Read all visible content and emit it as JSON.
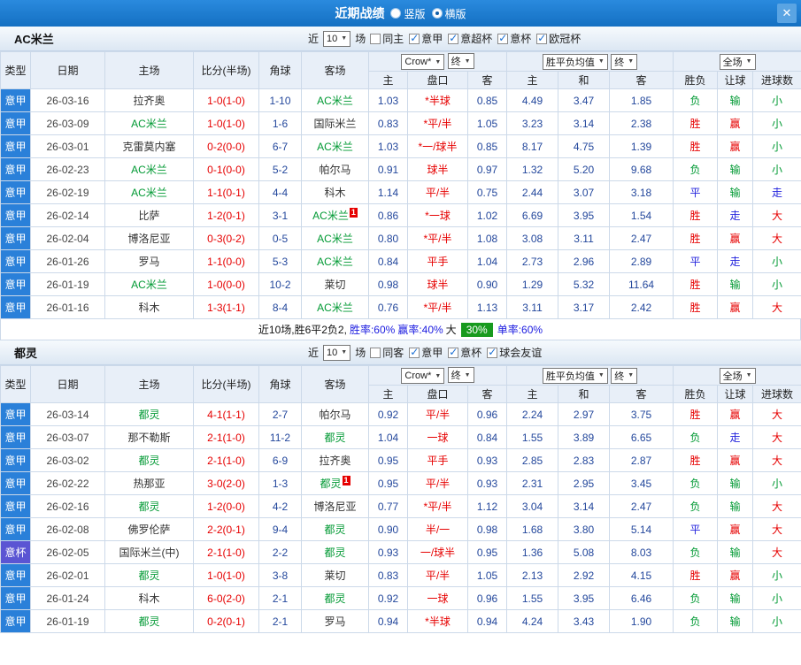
{
  "topbar": {
    "title": "近期战绩",
    "radios": [
      {
        "label": "竖版",
        "selected": false
      },
      {
        "label": "横版",
        "selected": true
      }
    ],
    "close_label": "✕"
  },
  "table": {
    "headers": {
      "type": "类型",
      "date": "日期",
      "home": "主场",
      "score": "比分(半场)",
      "corner": "角球",
      "away": "客场",
      "odds_home": "主",
      "handicap": "盘口",
      "odds_away": "客",
      "avg_home": "主",
      "avg_draw": "和",
      "avg_away": "客",
      "result": "胜负",
      "let_result": "让球",
      "goals": "进球数"
    },
    "dropdowns": {
      "odds_source": "Crow*",
      "odds_final": "终",
      "avg_source": "胜平负均值",
      "avg_final": "终",
      "scope": "全场"
    }
  },
  "colors": {
    "word": {
      "胜": "#e60000",
      "负": "#009933",
      "平": "#2323dd",
      "赢": "#e60000",
      "输": "#009933",
      "走": "#2323dd",
      "大": "#e60000",
      "小": "#009933"
    },
    "type_bg": {
      "意甲": "#2a80d9",
      "意杯": "#5b55d3"
    },
    "focus_team": "#009933",
    "plain_team": "#333333",
    "score": "#e60000",
    "corner": "#23479c",
    "odds": "#23479c",
    "handicap": "#e60000",
    "date": "#444444"
  },
  "sections": [
    {
      "team": "AC米兰",
      "filters": {
        "prefix": "近",
        "count": "10",
        "suffix": "场",
        "checkboxes": [
          {
            "label": "同主",
            "checked": false
          },
          {
            "label": "意甲",
            "checked": true
          },
          {
            "label": "意超杯",
            "checked": true
          },
          {
            "label": "意杯",
            "checked": true
          },
          {
            "label": "欧冠杯",
            "checked": true
          }
        ]
      },
      "rows": [
        {
          "type": "意甲",
          "date": "26-03-16",
          "home": {
            "name": "拉齐奥",
            "focus": false
          },
          "score": "1-0(1-0)",
          "corner": "1-10",
          "away": {
            "name": "AC米兰",
            "focus": true
          },
          "odds": [
            "1.03",
            "*半球",
            "0.85"
          ],
          "avg": [
            "4.49",
            "3.47",
            "1.85"
          ],
          "results": [
            "负",
            "输",
            "小"
          ]
        },
        {
          "type": "意甲",
          "date": "26-03-09",
          "home": {
            "name": "AC米兰",
            "focus": true
          },
          "score": "1-0(1-0)",
          "corner": "1-6",
          "away": {
            "name": "国际米兰",
            "focus": false
          },
          "odds": [
            "0.83",
            "*平/半",
            "1.05"
          ],
          "avg": [
            "3.23",
            "3.14",
            "2.38"
          ],
          "results": [
            "胜",
            "赢",
            "小"
          ]
        },
        {
          "type": "意甲",
          "date": "26-03-01",
          "home": {
            "name": "克雷莫内塞",
            "focus": false
          },
          "score": "0-2(0-0)",
          "corner": "6-7",
          "away": {
            "name": "AC米兰",
            "focus": true
          },
          "odds": [
            "1.03",
            "*一/球半",
            "0.85"
          ],
          "avg": [
            "8.17",
            "4.75",
            "1.39"
          ],
          "results": [
            "胜",
            "赢",
            "小"
          ]
        },
        {
          "type": "意甲",
          "date": "26-02-23",
          "home": {
            "name": "AC米兰",
            "focus": true
          },
          "score": "0-1(0-0)",
          "corner": "5-2",
          "away": {
            "name": "帕尔马",
            "focus": false
          },
          "odds": [
            "0.91",
            "球半",
            "0.97"
          ],
          "avg": [
            "1.32",
            "5.20",
            "9.68"
          ],
          "results": [
            "负",
            "输",
            "小"
          ]
        },
        {
          "type": "意甲",
          "date": "26-02-19",
          "home": {
            "name": "AC米兰",
            "focus": true
          },
          "score": "1-1(0-1)",
          "corner": "4-4",
          "away": {
            "name": "科木",
            "focus": false
          },
          "odds": [
            "1.14",
            "平/半",
            "0.75"
          ],
          "avg": [
            "2.44",
            "3.07",
            "3.18"
          ],
          "results": [
            "平",
            "输",
            "走"
          ]
        },
        {
          "type": "意甲",
          "date": "26-02-14",
          "home": {
            "name": "比萨",
            "focus": false
          },
          "score": "1-2(0-1)",
          "corner": "3-1",
          "away": {
            "name": "AC米兰",
            "focus": true,
            "badge": "1"
          },
          "odds": [
            "0.86",
            "*一球",
            "1.02"
          ],
          "avg": [
            "6.69",
            "3.95",
            "1.54"
          ],
          "results": [
            "胜",
            "走",
            "大"
          ]
        },
        {
          "type": "意甲",
          "date": "26-02-04",
          "home": {
            "name": "博洛尼亚",
            "focus": false
          },
          "score": "0-3(0-2)",
          "corner": "0-5",
          "away": {
            "name": "AC米兰",
            "focus": true
          },
          "odds": [
            "0.80",
            "*平/半",
            "1.08"
          ],
          "avg": [
            "3.08",
            "3.11",
            "2.47"
          ],
          "results": [
            "胜",
            "赢",
            "大"
          ]
        },
        {
          "type": "意甲",
          "date": "26-01-26",
          "home": {
            "name": "罗马",
            "focus": false
          },
          "score": "1-1(0-0)",
          "corner": "5-3",
          "away": {
            "name": "AC米兰",
            "focus": true
          },
          "odds": [
            "0.84",
            "平手",
            "1.04"
          ],
          "avg": [
            "2.73",
            "2.96",
            "2.89"
          ],
          "results": [
            "平",
            "走",
            "小"
          ]
        },
        {
          "type": "意甲",
          "date": "26-01-19",
          "home": {
            "name": "AC米兰",
            "focus": true
          },
          "score": "1-0(0-0)",
          "corner": "10-2",
          "away": {
            "name": "莱切",
            "focus": false
          },
          "odds": [
            "0.98",
            "球半",
            "0.90"
          ],
          "avg": [
            "1.29",
            "5.32",
            "11.64"
          ],
          "results": [
            "胜",
            "输",
            "小"
          ]
        },
        {
          "type": "意甲",
          "date": "26-01-16",
          "home": {
            "name": "科木",
            "focus": false
          },
          "score": "1-3(1-1)",
          "corner": "8-4",
          "away": {
            "name": "AC米兰",
            "focus": true
          },
          "odds": [
            "0.76",
            "*平/半",
            "1.13"
          ],
          "avg": [
            "3.11",
            "3.17",
            "2.42"
          ],
          "results": [
            "胜",
            "赢",
            "大"
          ]
        }
      ],
      "summary": [
        {
          "text": "近10场,胜6平2负2, ",
          "style": "plain"
        },
        {
          "text": "胜率:60%",
          "style": "blue"
        },
        {
          "text": " 赢率:40%",
          "style": "blue"
        },
        {
          "text": " 大 ",
          "style": "plain"
        },
        {
          "text": "30%",
          "style": "green-badge"
        },
        {
          "text": " 单率:60%",
          "style": "blue"
        }
      ]
    },
    {
      "team": "都灵",
      "filters": {
        "prefix": "近",
        "count": "10",
        "suffix": "场",
        "checkboxes": [
          {
            "label": "同客",
            "checked": false
          },
          {
            "label": "意甲",
            "checked": true
          },
          {
            "label": "意杯",
            "checked": true
          },
          {
            "label": "球会友谊",
            "checked": true
          }
        ]
      },
      "rows": [
        {
          "type": "意甲",
          "date": "26-03-14",
          "home": {
            "name": "都灵",
            "focus": true
          },
          "score": "4-1(1-1)",
          "corner": "2-7",
          "away": {
            "name": "帕尔马",
            "focus": false
          },
          "odds": [
            "0.92",
            "平/半",
            "0.96"
          ],
          "avg": [
            "2.24",
            "2.97",
            "3.75"
          ],
          "results": [
            "胜",
            "赢",
            "大"
          ]
        },
        {
          "type": "意甲",
          "date": "26-03-07",
          "home": {
            "name": "那不勒斯",
            "focus": false
          },
          "score": "2-1(1-0)",
          "corner": "11-2",
          "away": {
            "name": "都灵",
            "focus": true
          },
          "odds": [
            "1.04",
            "一球",
            "0.84"
          ],
          "avg": [
            "1.55",
            "3.89",
            "6.65"
          ],
          "results": [
            "负",
            "走",
            "大"
          ]
        },
        {
          "type": "意甲",
          "date": "26-03-02",
          "home": {
            "name": "都灵",
            "focus": true
          },
          "score": "2-1(1-0)",
          "corner": "6-9",
          "away": {
            "name": "拉齐奥",
            "focus": false
          },
          "odds": [
            "0.95",
            "平手",
            "0.93"
          ],
          "avg": [
            "2.85",
            "2.83",
            "2.87"
          ],
          "results": [
            "胜",
            "赢",
            "大"
          ]
        },
        {
          "type": "意甲",
          "date": "26-02-22",
          "home": {
            "name": "热那亚",
            "focus": false
          },
          "score": "3-0(2-0)",
          "corner": "1-3",
          "away": {
            "name": "都灵",
            "focus": true,
            "badge": "1"
          },
          "odds": [
            "0.95",
            "平/半",
            "0.93"
          ],
          "avg": [
            "2.31",
            "2.95",
            "3.45"
          ],
          "results": [
            "负",
            "输",
            "小"
          ]
        },
        {
          "type": "意甲",
          "date": "26-02-16",
          "home": {
            "name": "都灵",
            "focus": true
          },
          "score": "1-2(0-0)",
          "corner": "4-2",
          "away": {
            "name": "博洛尼亚",
            "focus": false
          },
          "odds": [
            "0.77",
            "*平/半",
            "1.12"
          ],
          "avg": [
            "3.04",
            "3.14",
            "2.47"
          ],
          "results": [
            "负",
            "输",
            "大"
          ]
        },
        {
          "type": "意甲",
          "date": "26-02-08",
          "home": {
            "name": "佛罗伦萨",
            "focus": false
          },
          "score": "2-2(0-1)",
          "corner": "9-4",
          "away": {
            "name": "都灵",
            "focus": true
          },
          "odds": [
            "0.90",
            "半/一",
            "0.98"
          ],
          "avg": [
            "1.68",
            "3.80",
            "5.14"
          ],
          "results": [
            "平",
            "赢",
            "大"
          ]
        },
        {
          "type": "意杯",
          "date": "26-02-05",
          "home": {
            "name": "国际米兰(中)",
            "focus": false
          },
          "score": "2-1(1-0)",
          "corner": "2-2",
          "away": {
            "name": "都灵",
            "focus": true
          },
          "odds": [
            "0.93",
            "一/球半",
            "0.95"
          ],
          "avg": [
            "1.36",
            "5.08",
            "8.03"
          ],
          "results": [
            "负",
            "输",
            "大"
          ]
        },
        {
          "type": "意甲",
          "date": "26-02-01",
          "home": {
            "name": "都灵",
            "focus": true
          },
          "score": "1-0(1-0)",
          "corner": "3-8",
          "away": {
            "name": "莱切",
            "focus": false
          },
          "odds": [
            "0.83",
            "平/半",
            "1.05"
          ],
          "avg": [
            "2.13",
            "2.92",
            "4.15"
          ],
          "results": [
            "胜",
            "赢",
            "小"
          ]
        },
        {
          "type": "意甲",
          "date": "26-01-24",
          "home": {
            "name": "科木",
            "focus": false
          },
          "score": "6-0(2-0)",
          "corner": "2-1",
          "away": {
            "name": "都灵",
            "focus": true
          },
          "odds": [
            "0.92",
            "一球",
            "0.96"
          ],
          "avg": [
            "1.55",
            "3.95",
            "6.46"
          ],
          "results": [
            "负",
            "输",
            "小"
          ]
        },
        {
          "type": "意甲",
          "date": "26-01-19",
          "home": {
            "name": "都灵",
            "focus": true
          },
          "score": "0-2(0-1)",
          "corner": "2-1",
          "away": {
            "name": "罗马",
            "focus": false
          },
          "odds": [
            "0.94",
            "*半球",
            "0.94"
          ],
          "avg": [
            "4.24",
            "3.43",
            "1.90"
          ],
          "results": [
            "负",
            "输",
            "小"
          ]
        }
      ],
      "summary": null
    }
  ]
}
